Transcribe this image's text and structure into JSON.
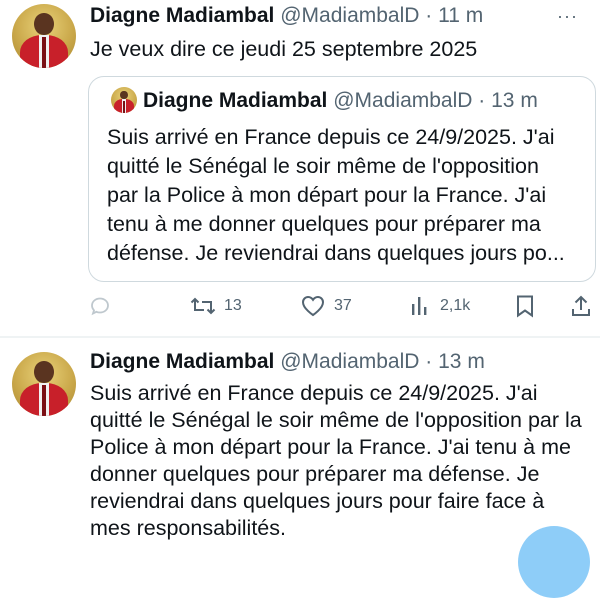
{
  "tweet1": {
    "author_name": "Diagne Madiambal",
    "handle": "@MadiambalD",
    "time_separator": "·",
    "time": "11 m",
    "text": "Je veux dire ce jeudi 25 septembre 2025",
    "quoted": {
      "author_name": "Diagne Madiambal",
      "handle": "@MadiambalD",
      "time_separator": "·",
      "time": "13 m",
      "lines": [
        "Suis arrivé en France depuis ce 24/9/2025. J'ai",
        "quitté le Sénégal le soir même de l'opposition",
        "par la Police à mon départ pour la France. J'ai",
        "tenu à me donner quelques pour préparer ma",
        "défense. Je reviendrai dans quelques jours po..."
      ]
    },
    "actions": {
      "reply_icon": "reply-icon",
      "retweet_count": "13",
      "like_count": "37",
      "views_count": "2,1k"
    }
  },
  "tweet2": {
    "author_name": "Diagne Madiambal",
    "handle": "@MadiambalD",
    "time_separator": "·",
    "time": "13 m",
    "lines": [
      "Suis arrivé en France depuis ce 24/9/2025. J'ai",
      "quitté le Sénégal le soir même de l'opposition par la",
      "Police à mon départ pour la France. J'ai tenu à me",
      "donner quelques pour préparer ma défense. Je",
      "reviendrai dans quelques jours pour faire face à",
      "mes responsabilités."
    ]
  },
  "colors": {
    "text": "#0f1419",
    "muted": "#536471",
    "border": "#cfd9de",
    "accent": "#1d9bf0"
  }
}
